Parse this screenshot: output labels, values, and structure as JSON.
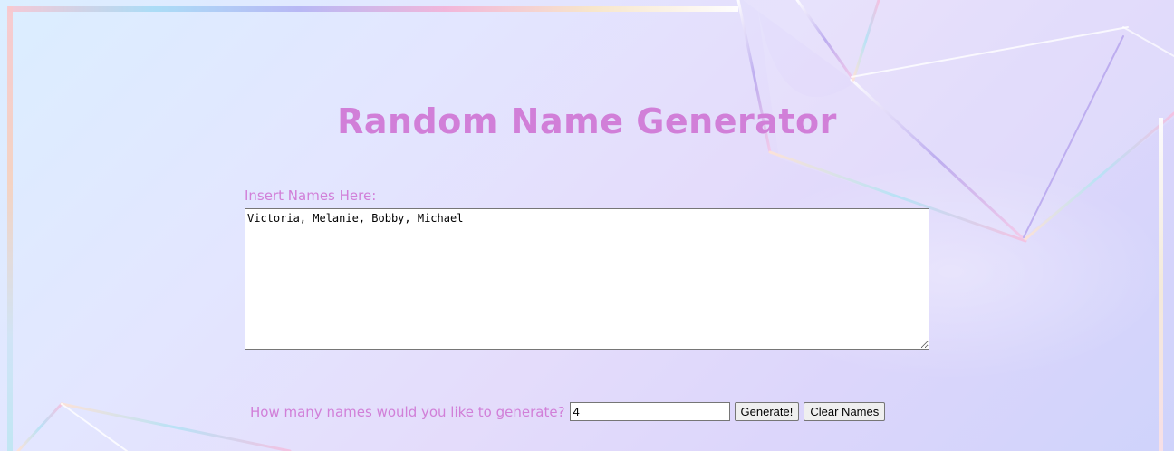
{
  "page": {
    "title": "Random Name Generator"
  },
  "names": {
    "label": "Insert Names Here:",
    "value": "Victoria, Melanie, Bobby, Michael"
  },
  "count": {
    "label": "How many names would you like to generate?",
    "value": "4"
  },
  "buttons": {
    "generate_label": "Generate!",
    "clear_label": "Clear Names"
  },
  "colors": {
    "accent": "#d17fd8",
    "background_start": "#dbeeff",
    "background_end": "#cfd3fb"
  }
}
